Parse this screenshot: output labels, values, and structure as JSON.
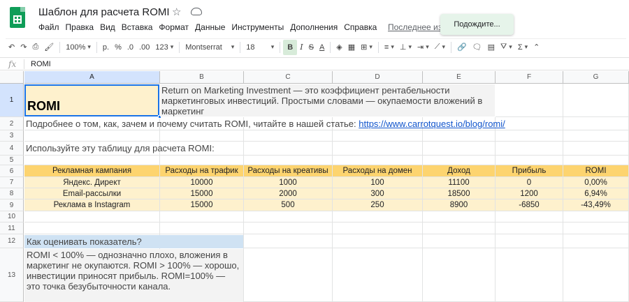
{
  "title": "Шаблон для расчета ROMI",
  "menu": [
    "Файл",
    "Правка",
    "Вид",
    "Вставка",
    "Формат",
    "Данные",
    "Инструменты",
    "Дополнения",
    "Справка"
  ],
  "last_edit": "Последнее изм",
  "toast": "Подождите...",
  "toolbar": {
    "zoom": "100%",
    "currency": "р.",
    "percent": "%",
    "dec_less": ".0",
    "dec_more": ".00",
    "more_formats": "123",
    "font": "Montserrat",
    "font_size": "18",
    "bold": "B",
    "italic": "I",
    "strike": "S",
    "text_color": "A",
    "more": "Σ"
  },
  "formula_bar": {
    "fx": "fx",
    "content": "ROMI"
  },
  "columns": [
    "A",
    "B",
    "C",
    "D",
    "E",
    "F",
    "G"
  ],
  "rows": [
    "1",
    "2",
    "3",
    "4",
    "5",
    "6",
    "7",
    "8",
    "9",
    "10",
    "11",
    "12",
    "13"
  ],
  "cells": {
    "a1": "ROMI",
    "desc": "Return on Marketing Investment — это коэффициент рентабельности маркетинговых инвестиций. Простыми словами — окупаемости вложений в маркетинг",
    "a2_text": "Подробнее о том, как, зачем и почему считать ROMI, читайте в нашей статье: ",
    "a2_link": "https://www.carrotquest.io/blog/romi/",
    "a4": "Используйте эту таблицу для расчета ROMI:",
    "question": "Как оценивать показатель?",
    "answer": "ROMI < 100% — однозначно плохо, вложения в маркетинг не окупаются. ROMI > 100% — хорошо, инвестиции приносят прибыль. ROMI=100% — это точка безубыточности канала."
  },
  "table": {
    "headers": [
      "Рекламная кампания",
      "Расходы на трафик",
      "Расходы на креативы",
      "Расходы на домен",
      "Доход",
      "Прибыль",
      "ROMI"
    ],
    "rows": [
      [
        "Яндекс. Директ",
        "10000",
        "1000",
        "100",
        "11100",
        "0",
        "0,00%"
      ],
      [
        "Email-рассылки",
        "15000",
        "2000",
        "300",
        "18500",
        "1200",
        "6,94%"
      ],
      [
        "Реклама в Instagram",
        "15000",
        "500",
        "250",
        "8900",
        "-6850",
        "-43,49%"
      ]
    ]
  },
  "colors": {
    "header_fill": "#fdd46f",
    "body_fill": "#fef1cd",
    "question_fill": "#cfe2f3",
    "selection": "#1a73e8",
    "logo": "#0f9d58"
  }
}
